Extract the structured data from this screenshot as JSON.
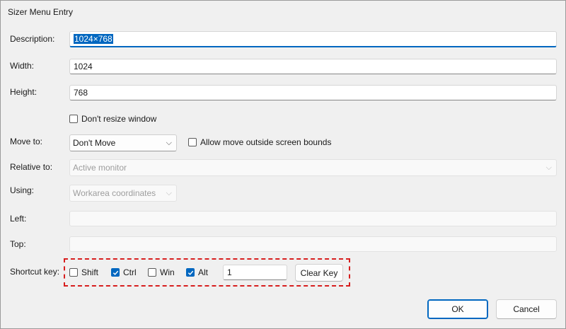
{
  "window": {
    "title": "Sizer Menu Entry"
  },
  "description": {
    "label": "Description:",
    "value": "1024×768"
  },
  "width": {
    "label": "Width:",
    "value": "1024"
  },
  "height": {
    "label": "Height:",
    "value": "768"
  },
  "dont_resize": {
    "label": "Don't resize window",
    "checked": false
  },
  "move_to": {
    "label": "Move to:",
    "selected": "Don't Move"
  },
  "allow_outside": {
    "label": "Allow move outside screen bounds",
    "checked": false
  },
  "relative_to": {
    "label": "Relative to:",
    "selected": "Active monitor"
  },
  "using": {
    "label": "Using:",
    "selected": "Workarea coordinates"
  },
  "left": {
    "label": "Left:",
    "value": ""
  },
  "top": {
    "label": "Top:",
    "value": ""
  },
  "shortcut": {
    "label": "Shortcut key:",
    "shift": {
      "label": "Shift",
      "checked": false
    },
    "ctrl": {
      "label": "Ctrl",
      "checked": true
    },
    "win": {
      "label": "Win",
      "checked": false
    },
    "alt": {
      "label": "Alt",
      "checked": true
    },
    "key_value": "1",
    "clear_label": "Clear Key"
  },
  "buttons": {
    "ok": "OK",
    "cancel": "Cancel"
  },
  "colors": {
    "accent": "#0067c0",
    "highlight_border": "#d71e1e"
  },
  "icons": {
    "dropdown": "chevron-down-icon",
    "check": "checkmark-icon"
  }
}
